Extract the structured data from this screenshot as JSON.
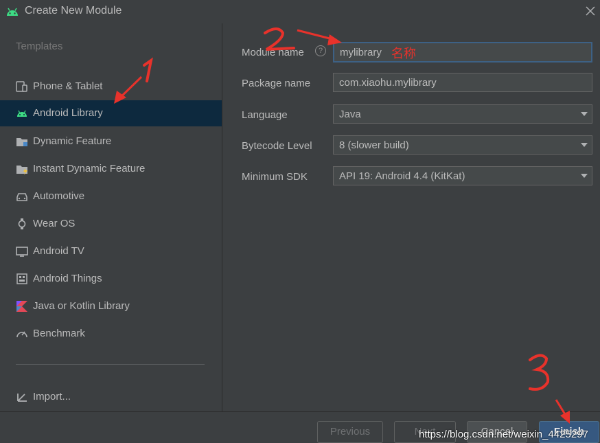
{
  "window": {
    "title": "Create New Module"
  },
  "sidebar": {
    "header": "Templates",
    "items": [
      {
        "label": "Phone & Tablet",
        "icon": "phone-tablet-icon"
      },
      {
        "label": "Android Library",
        "icon": "android-icon",
        "selected": true
      },
      {
        "label": "Dynamic Feature",
        "icon": "folder-feature-icon"
      },
      {
        "label": "Instant Dynamic Feature",
        "icon": "folder-instant-icon"
      },
      {
        "label": "Automotive",
        "icon": "car-icon"
      },
      {
        "label": "Wear OS",
        "icon": "watch-icon"
      },
      {
        "label": "Android TV",
        "icon": "tv-icon"
      },
      {
        "label": "Android Things",
        "icon": "things-icon"
      },
      {
        "label": "Java or Kotlin Library",
        "icon": "kotlin-icon"
      },
      {
        "label": "Benchmark",
        "icon": "gauge-icon"
      }
    ],
    "import_label": "Import..."
  },
  "form": {
    "module_name": {
      "label": "Module name",
      "value": "mylibrary"
    },
    "package_name": {
      "label": "Package name",
      "value": "com.xiaohu.mylibrary"
    },
    "language": {
      "label": "Language",
      "value": "Java"
    },
    "bytecode": {
      "label": "Bytecode Level",
      "value": "8 (slower build)"
    },
    "min_sdk": {
      "label": "Minimum SDK",
      "value": "API 19: Android 4.4 (KitKat)"
    }
  },
  "annotations": {
    "name_note": "名称"
  },
  "footer": {
    "previous": "Previous",
    "next": "Next",
    "cancel": "Cancel",
    "finish": "Finish"
  },
  "watermark": "https://blog.csdn.net/weixin_4425297",
  "colors": {
    "background": "#3c3f41",
    "selection": "#0d293e",
    "accent": "#365880",
    "annotation": "#e8322b",
    "android_green": "#3ddc84"
  }
}
